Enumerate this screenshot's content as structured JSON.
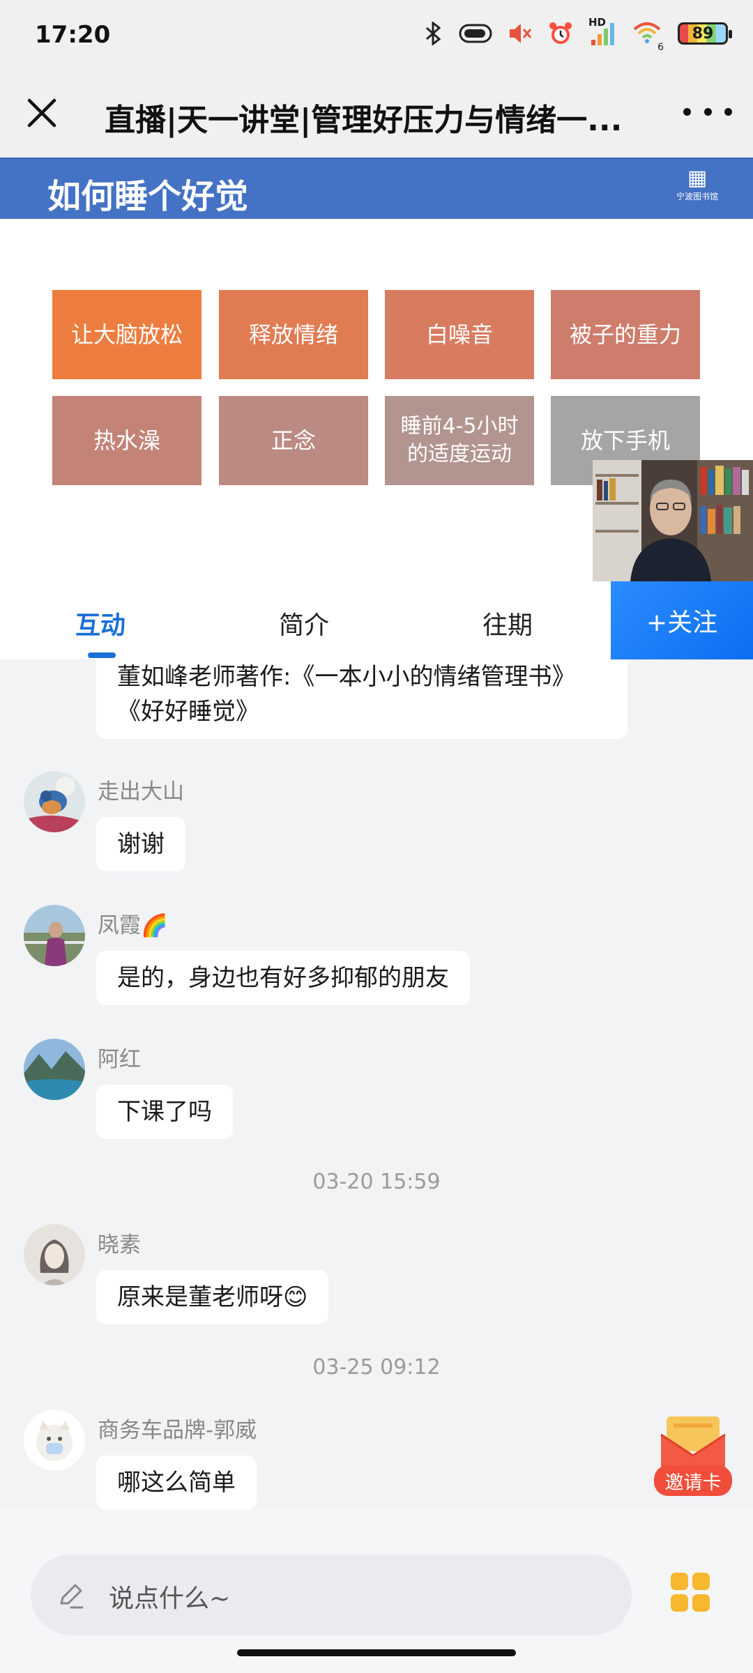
{
  "status": {
    "time": "17:20",
    "hd_label": "HD",
    "wifi_badge": "6",
    "battery": "89"
  },
  "header": {
    "title": "直播|天一讲堂|管理好压力与情绪一..."
  },
  "slide": {
    "title": "如何睡个好觉",
    "logo_text": "宁波图书馆",
    "tiles": [
      {
        "label": "让大脑放松",
        "color": "#ed7d3f"
      },
      {
        "label": "释放情绪",
        "color": "#e07b52"
      },
      {
        "label": "白噪音",
        "color": "#d87c60"
      },
      {
        "label": "被子的重力",
        "color": "#ce7d6c"
      },
      {
        "label": "热水澡",
        "color": "#c38377"
      },
      {
        "label": "正念",
        "color": "#bb8a82"
      },
      {
        "label": "睡前4-5小时的适度运动",
        "color": "#b2958f"
      },
      {
        "label": "放下手机",
        "color": "#a5a5a5"
      }
    ]
  },
  "tabs": {
    "items": [
      "互动",
      "简介",
      "往期"
    ],
    "follow": "+关注"
  },
  "chat": {
    "pinned": "董如峰老师著作:《一本小小的情绪管理书》《好好睡觉》",
    "messages": [
      {
        "user": "走出大山",
        "text": "谢谢"
      },
      {
        "user": "凤霞🌈",
        "text": "是的，身边也有好多抑郁的朋友"
      },
      {
        "user": "阿红",
        "text": "下课了吗"
      },
      {
        "user": "晓素",
        "text": "原来是董老师呀😊"
      },
      {
        "user": "商务车品牌-郭威",
        "text": "哪这么简单"
      }
    ],
    "timestamps": [
      "03-20 15:59",
      "03-25 09:12"
    ]
  },
  "invite_card": {
    "label": "邀请卡"
  },
  "input": {
    "placeholder": "说点什么~"
  }
}
